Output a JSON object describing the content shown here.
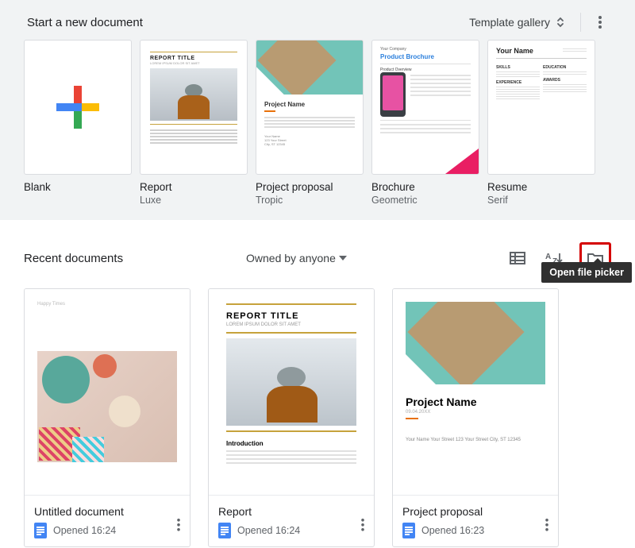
{
  "template_section": {
    "heading": "Start a new document",
    "gallery_button": "Template gallery",
    "templates": [
      {
        "title": "Blank",
        "subtitle": ""
      },
      {
        "title": "Report",
        "subtitle": "Luxe"
      },
      {
        "title": "Project proposal",
        "subtitle": "Tropic"
      },
      {
        "title": "Brochure",
        "subtitle": "Geometric"
      },
      {
        "title": "Resume",
        "subtitle": "Serif"
      }
    ]
  },
  "recent_section": {
    "heading": "Recent documents",
    "filter_label": "Owned by anyone",
    "tooltip": "Open file picker"
  },
  "documents": [
    {
      "title": "Untitled document",
      "meta": "Opened 16:24"
    },
    {
      "title": "Report",
      "meta": "Opened 16:24"
    },
    {
      "title": "Project proposal",
      "meta": "Opened 16:23"
    }
  ],
  "thumb_text": {
    "report_title": "REPORT TITLE",
    "report_sub": "LOREM IPSUM DOLOR SIT AMET",
    "report_intro": "Introduction",
    "project_name": "Project Name",
    "project_date": "09.04.20XX",
    "project_footer": "Your Name\nYour Street\n123 Your Street\nCity, ST 12345",
    "brochure_company": "Your Company",
    "brochure_product": "Product Brochure",
    "brochure_overview": "Product Overview",
    "resume_name": "Your Name",
    "happy_times": "Happy Times"
  }
}
